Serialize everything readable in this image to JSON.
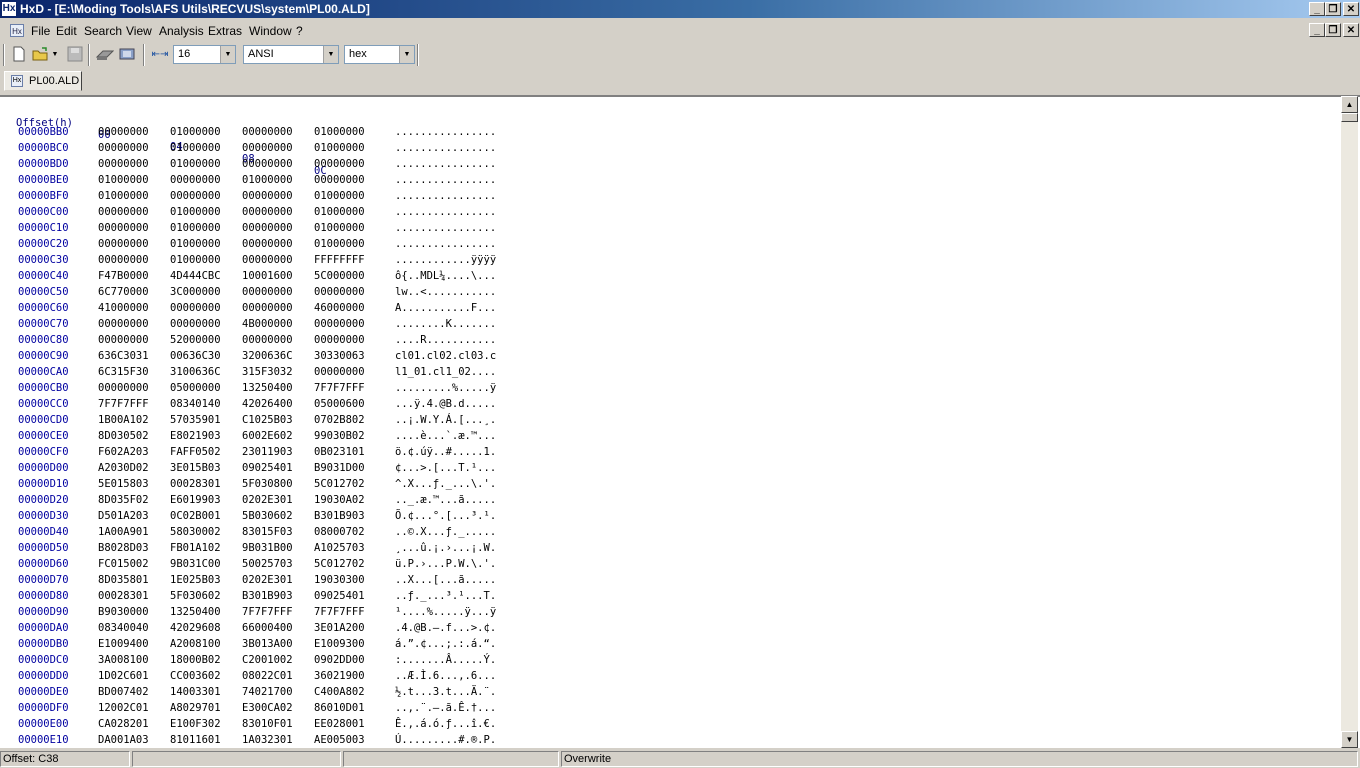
{
  "window": {
    "app_icon": "Hx",
    "title": "HxD - [E:\\Moding Tools\\AFS Utils\\RECVUS\\system\\PL00.ALD]",
    "controls": [
      "_",
      "❐",
      "✕"
    ]
  },
  "menu": {
    "doc_icon": "hex-document-icon",
    "items": [
      "File",
      "Edit",
      "Search",
      "View",
      "Analysis",
      "Extras",
      "Window",
      "?"
    ]
  },
  "toolbar": {
    "bytes_per_row": "16",
    "charset": "ANSI",
    "display_mode": "hex"
  },
  "tabs": [
    {
      "label": "PL00.ALD"
    }
  ],
  "hex_header": {
    "offset_label": "Offset(h)",
    "columns": [
      "00",
      "04",
      "08",
      "0C"
    ]
  },
  "rows": [
    {
      "off": "00000BB0",
      "g": [
        "00000000",
        "01000000",
        "00000000",
        "01000000"
      ],
      "t": "................"
    },
    {
      "off": "00000BC0",
      "g": [
        "00000000",
        "01000000",
        "00000000",
        "01000000"
      ],
      "t": "................"
    },
    {
      "off": "00000BD0",
      "g": [
        "00000000",
        "01000000",
        "00000000",
        "00000000"
      ],
      "t": "................"
    },
    {
      "off": "00000BE0",
      "g": [
        "01000000",
        "00000000",
        "01000000",
        "00000000"
      ],
      "t": "................"
    },
    {
      "off": "00000BF0",
      "g": [
        "01000000",
        "00000000",
        "00000000",
        "01000000"
      ],
      "t": "................"
    },
    {
      "off": "00000C00",
      "g": [
        "00000000",
        "01000000",
        "00000000",
        "01000000"
      ],
      "t": "................"
    },
    {
      "off": "00000C10",
      "g": [
        "00000000",
        "01000000",
        "00000000",
        "01000000"
      ],
      "t": "................"
    },
    {
      "off": "00000C20",
      "g": [
        "00000000",
        "01000000",
        "00000000",
        "01000000"
      ],
      "t": "................"
    },
    {
      "off": "00000C30",
      "g": [
        "00000000",
        "01000000",
        "00000000",
        "FFFFFFFF"
      ],
      "t": "............ÿÿÿÿ"
    },
    {
      "off": "00000C40",
      "g": [
        "F47B0000",
        "4D444CBC",
        "10001600",
        "5C000000"
      ],
      "t": "ô{..MDL¼....\\..."
    },
    {
      "off": "00000C50",
      "g": [
        "6C770000",
        "3C000000",
        "00000000",
        "00000000"
      ],
      "t": "lw..<..........."
    },
    {
      "off": "00000C60",
      "g": [
        "41000000",
        "00000000",
        "00000000",
        "46000000"
      ],
      "t": "A...........F..."
    },
    {
      "off": "00000C70",
      "g": [
        "00000000",
        "00000000",
        "4B000000",
        "00000000"
      ],
      "t": "........K......."
    },
    {
      "off": "00000C80",
      "g": [
        "00000000",
        "52000000",
        "00000000",
        "00000000"
      ],
      "t": "....R..........."
    },
    {
      "off": "00000C90",
      "g": [
        "636C3031",
        "00636C30",
        "3200636C",
        "30330063"
      ],
      "t": "cl01.cl02.cl03.c"
    },
    {
      "off": "00000CA0",
      "g": [
        "6C315F30",
        "3100636C",
        "315F3032",
        "00000000"
      ],
      "t": "l1_01.cl1_02...."
    },
    {
      "off": "00000CB0",
      "g": [
        "00000000",
        "05000000",
        "13250400",
        "7F7F7FFF"
      ],
      "t": ".........%.....ÿ"
    },
    {
      "off": "00000CC0",
      "g": [
        "7F7F7FFF",
        "08340140",
        "42026400",
        "05000600"
      ],
      "t": "...ÿ.4.@B.d....."
    },
    {
      "off": "00000CD0",
      "g": [
        "1B00A102",
        "57035901",
        "C1025B03",
        "0702B802"
      ],
      "t": "..¡.W.Y.Á.[...¸."
    },
    {
      "off": "00000CE0",
      "g": [
        "8D030502",
        "E8021903",
        "6002E602",
        "99030B02"
      ],
      "t": "....è...`.æ.™..."
    },
    {
      "off": "00000CF0",
      "g": [
        "F602A203",
        "FAFF0502",
        "23011903",
        "0B023101"
      ],
      "t": "ö.¢.úÿ..#.....1."
    },
    {
      "off": "00000D00",
      "g": [
        "A2030D02",
        "3E015B03",
        "09025401",
        "B9031D00"
      ],
      "t": "¢...>.[...T.¹..."
    },
    {
      "off": "00000D10",
      "g": [
        "5E015803",
        "00028301",
        "5F030800",
        "5C012702"
      ],
      "t": "^.X...ƒ._...\\.'."
    },
    {
      "off": "00000D20",
      "g": [
        "8D035F02",
        "E6019903",
        "0202E301",
        "19030A02"
      ],
      "t": ".._.æ.™...ã....."
    },
    {
      "off": "00000D30",
      "g": [
        "D501A203",
        "0C02B001",
        "5B030602",
        "B301B903"
      ],
      "t": "Õ.¢...°.[...³.¹."
    },
    {
      "off": "00000D40",
      "g": [
        "1A00A901",
        "58030002",
        "83015F03",
        "08000702"
      ],
      "t": "..©.X...ƒ._....."
    },
    {
      "off": "00000D50",
      "g": [
        "B8028D03",
        "FB01A102",
        "9B031B00",
        "A1025703"
      ],
      "t": "¸...û.¡.›...¡.W."
    },
    {
      "off": "00000D60",
      "g": [
        "FC015002",
        "9B031C00",
        "50025703",
        "5C012702"
      ],
      "t": "ü.P.›...P.W.\\.'."
    },
    {
      "off": "00000D70",
      "g": [
        "8D035801",
        "1E025B03",
        "0202E301",
        "19030300"
      ],
      "t": "..X...[...ã....."
    },
    {
      "off": "00000D80",
      "g": [
        "00028301",
        "5F030602",
        "B301B903",
        "09025401"
      ],
      "t": "..ƒ._...³.¹...T."
    },
    {
      "off": "00000D90",
      "g": [
        "B9030000",
        "13250400",
        "7F7F7FFF",
        "7F7F7FFF"
      ],
      "t": "¹....%.....ÿ...ÿ"
    },
    {
      "off": "00000DA0",
      "g": [
        "08340040",
        "42029608",
        "66000400",
        "3E01A200"
      ],
      "t": ".4.@B.–.f...>.¢."
    },
    {
      "off": "00000DB0",
      "g": [
        "E1009400",
        "A2008100",
        "3B013A00",
        "E1009300"
      ],
      "t": "á.”.¢...;.:.á.“."
    },
    {
      "off": "00000DC0",
      "g": [
        "3A008100",
        "18000B02",
        "C2001002",
        "0902DD00"
      ],
      "t": ":.......Â.....Ý."
    },
    {
      "off": "00000DD0",
      "g": [
        "1D02C601",
        "CC003602",
        "08022C01",
        "36021900"
      ],
      "t": "..Æ.Ì.6...,.6..."
    },
    {
      "off": "00000DE0",
      "g": [
        "BD007402",
        "14003301",
        "74021700",
        "C400A802"
      ],
      "t": "½.t...3.t...Ä.¨."
    },
    {
      "off": "00000DF0",
      "g": [
        "12002C01",
        "A8029701",
        "E300CA02",
        "86010D01"
      ],
      "t": "..,.¨.—.ã.Ê.†..."
    },
    {
      "off": "00000E00",
      "g": [
        "CA028201",
        "E100F302",
        "83010F01",
        "EE028001"
      ],
      "t": "Ê.‚.á.ó.ƒ...î.€."
    },
    {
      "off": "00000E10",
      "g": [
        "DA001A03",
        "81011601",
        "1A032301",
        "AE005003"
      ],
      "t": "Ú.........#.®.P."
    }
  ],
  "status": {
    "offset": "Offset: C38",
    "mode": "Overwrite"
  }
}
